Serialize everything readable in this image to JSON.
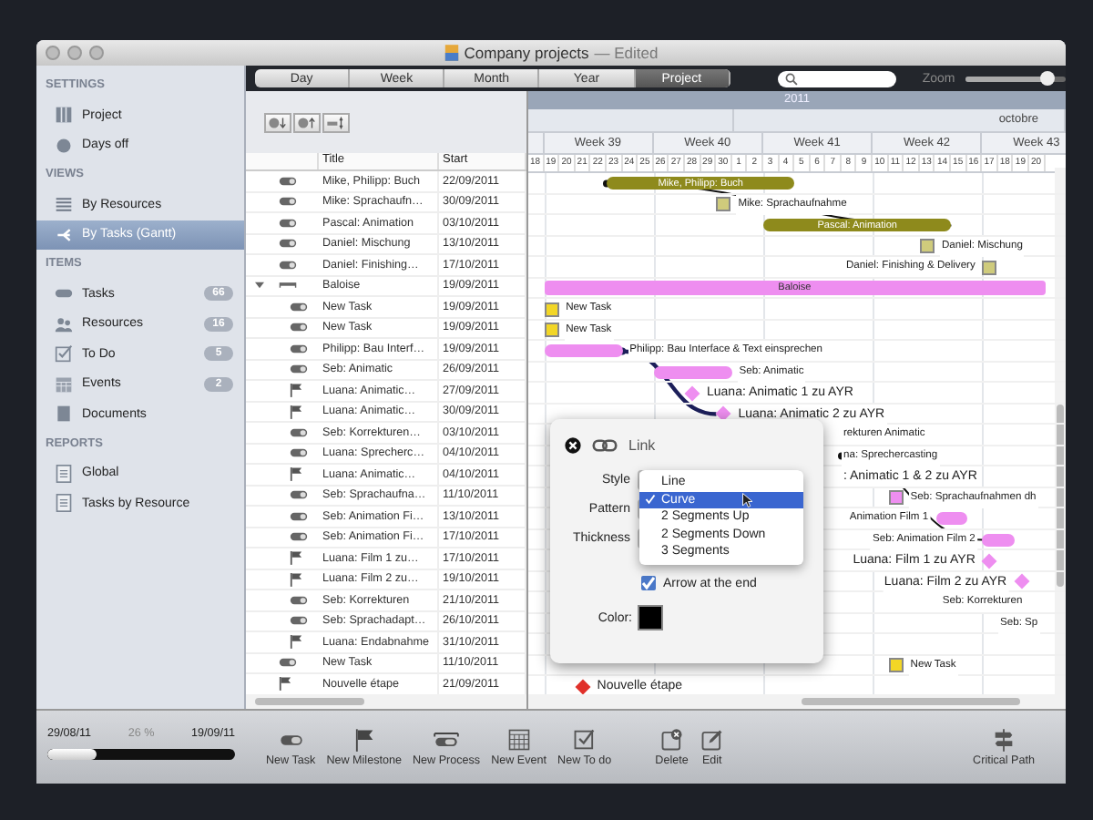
{
  "window": {
    "title": "Company projects",
    "status": "— Edited"
  },
  "sidebar": {
    "sections": [
      {
        "title": "SETTINGS",
        "items": [
          {
            "label": "Project",
            "selected": false
          },
          {
            "label": "Days off",
            "selected": false
          }
        ]
      },
      {
        "title": "VIEWS",
        "items": [
          {
            "label": "By Resources",
            "selected": false
          },
          {
            "label": "By Tasks (Gantt)",
            "selected": true
          }
        ]
      },
      {
        "title": "ITEMS",
        "items": [
          {
            "label": "Tasks",
            "count": "66",
            "selected": false
          },
          {
            "label": "Resources",
            "count": "16",
            "selected": false
          },
          {
            "label": "To Do",
            "count": "5",
            "selected": false
          },
          {
            "label": "Events",
            "count": "2",
            "selected": false
          },
          {
            "label": "Documents",
            "selected": false
          }
        ]
      },
      {
        "title": "REPORTS",
        "items": [
          {
            "label": "Global",
            "selected": false
          },
          {
            "label": "Tasks by Resource",
            "selected": false
          }
        ]
      }
    ],
    "progress": {
      "start": "29/08/11",
      "percent": "26 %",
      "end": "19/09/11",
      "level": 0.26
    }
  },
  "view_tabs": [
    {
      "label": "Day",
      "selected": false
    },
    {
      "label": "Week",
      "selected": false
    },
    {
      "label": "Month",
      "selected": false
    },
    {
      "label": "Year",
      "selected": false
    },
    {
      "label": "Project",
      "selected": true
    }
  ],
  "zoom": {
    "label": "Zoom",
    "level": 0.82
  },
  "table": {
    "columns": [
      "Title",
      "Start"
    ],
    "rows": [
      {
        "kind": "task",
        "title": "Mike, Philipp: Buch",
        "start": "22/09/2011",
        "bar": {
          "kind": "bar",
          "color": "#8e8a1c",
          "label": "Mike, Philipp: Buch"
        }
      },
      {
        "kind": "task",
        "title": "Mike: Sprachaufn…",
        "start": "30/09/2011",
        "bar": {
          "kind": "box",
          "color": "#cfcb7c",
          "label": "Mike: Sprachaufnahme"
        }
      },
      {
        "kind": "task",
        "title": "Pascal: Animation",
        "start": "03/10/2011",
        "bar": {
          "kind": "bar",
          "color": "#8e8a1c",
          "label": "Pascal: Animation"
        }
      },
      {
        "kind": "task",
        "title": "Daniel: Mischung",
        "start": "13/10/2011",
        "bar": {
          "kind": "box",
          "color": "#cfcb7c",
          "label": "Daniel: Mischung"
        }
      },
      {
        "kind": "task",
        "title": "Daniel: Finishing…",
        "start": "17/10/2011",
        "bar": {
          "kind": "box",
          "color": "#cfcb7c",
          "label": "Daniel: Finishing & Delivery"
        }
      },
      {
        "kind": "summary",
        "expanded": true,
        "title": "Baloise",
        "start": "19/09/2011",
        "bar": {
          "kind": "summary",
          "color": "#ee8ef0",
          "label": "Baloise"
        }
      },
      {
        "kind": "task",
        "title": "New Task",
        "start": "19/09/2011",
        "bar": {
          "kind": "box",
          "color": "#f2d626",
          "label": "New Task"
        }
      },
      {
        "kind": "task",
        "title": "New Task",
        "start": "19/09/2011",
        "bar": {
          "kind": "box",
          "color": "#f2d626",
          "label": "New Task"
        }
      },
      {
        "kind": "task",
        "title": "Philipp: Bau Interf…",
        "start": "19/09/2011",
        "bar": {
          "kind": "bar",
          "color": "#ee8ef0",
          "label": "Philipp: Bau Interface & Text einsprechen"
        }
      },
      {
        "kind": "task",
        "title": "Seb: Animatic",
        "start": "26/09/2011",
        "bar": {
          "kind": "bar",
          "color": "#ee8ef0",
          "label": "Seb: Animatic"
        }
      },
      {
        "kind": "milestone",
        "title": "Luana: Animatic…",
        "start": "27/09/2011",
        "bar": {
          "kind": "milestone",
          "color": "#ee8ef0",
          "label": "Luana: Animatic 1 zu AYR"
        }
      },
      {
        "kind": "milestone",
        "title": "Luana: Animatic…",
        "start": "30/09/2011",
        "bar": {
          "kind": "milestone",
          "color": "#ee8ef0",
          "label": "Luana: Animatic 2 zu AYR"
        }
      },
      {
        "kind": "task",
        "title": "Seb: Korrekturen…",
        "start": "03/10/2011",
        "bar": {
          "kind": "none",
          "label": "rekturen Animatic"
        }
      },
      {
        "kind": "task",
        "title": "Luana: Sprecherc…",
        "start": "04/10/2011",
        "bar": {
          "kind": "none",
          "label": "na: Sprechercasting"
        }
      },
      {
        "kind": "milestone",
        "title": "Luana: Animatic…",
        "start": "04/10/2011",
        "bar": {
          "kind": "none",
          "label": ": Animatic 1 & 2 zu AYR"
        }
      },
      {
        "kind": "task",
        "title": "Seb: Sprachaufna…",
        "start": "11/10/2011",
        "bar": {
          "kind": "box",
          "color": "#ee8ef0",
          "label": "Seb: Sprachaufnahmen dh"
        }
      },
      {
        "kind": "task",
        "title": "Seb: Animation Fi…",
        "start": "13/10/2011",
        "bar": {
          "kind": "bar",
          "color": "#ee8ef0",
          "label": "Animation Film 1"
        }
      },
      {
        "kind": "task",
        "title": "Seb: Animation Fi…",
        "start": "17/10/2011",
        "bar": {
          "kind": "bar",
          "color": "#ee8ef0",
          "label": "Seb: Animation Film 2"
        }
      },
      {
        "kind": "milestone",
        "title": "Luana: Film 1 zu…",
        "start": "17/10/2011",
        "bar": {
          "kind": "milestone",
          "color": "#ee8ef0",
          "label": "Luana: Film 1 zu AYR"
        }
      },
      {
        "kind": "milestone",
        "title": "Luana: Film 2 zu…",
        "start": "19/10/2011",
        "bar": {
          "kind": "milestone",
          "color": "#ee8ef0",
          "label": "Luana: Film 2 zu AYR"
        }
      },
      {
        "kind": "task",
        "title": "Seb: Korrekturen",
        "start": "21/10/2011",
        "bar": {
          "kind": "none",
          "label": "Seb: Korrekturen"
        }
      },
      {
        "kind": "task",
        "title": "Seb: Sprachadapt…",
        "start": "26/10/2011",
        "bar": {
          "kind": "none",
          "label": "Seb: Sp"
        }
      },
      {
        "kind": "milestone",
        "title": "Luana: Endabnahme",
        "start": "31/10/2011"
      },
      {
        "kind": "task",
        "title": "New Task",
        "start": "11/10/2011",
        "bar": {
          "kind": "box",
          "color": "#f2d626",
          "label": "New Task"
        }
      },
      {
        "kind": "milestone",
        "title": "Nouvelle étape",
        "start": "21/09/2011",
        "bar": {
          "kind": "milestone",
          "color": "#e0302a",
          "label": "Nouvelle étape"
        }
      }
    ]
  },
  "gantt": {
    "year": "2011",
    "month": "octobre",
    "weeks": [
      "Week 39",
      "Week 40",
      "Week 41",
      "Week 42",
      "Week 43"
    ],
    "days": [
      "18",
      "19",
      "20",
      "21",
      "22",
      "23",
      "24",
      "25",
      "26",
      "27",
      "28",
      "29",
      "30",
      "1",
      "2",
      "3",
      "4",
      "5",
      "6",
      "7",
      "8",
      "9",
      "10",
      "11",
      "12",
      "13",
      "14",
      "15",
      "16",
      "17",
      "18",
      "19",
      "20"
    ],
    "links": [
      {
        "selected": false
      },
      {
        "selected": true
      },
      {
        "selected": false
      }
    ]
  },
  "link_popover": {
    "title": "Link",
    "fields": [
      "Style",
      "Pattern",
      "Thickness"
    ],
    "style_options": [
      {
        "label": "Line",
        "selected": false
      },
      {
        "label": "Curve",
        "selected": true
      },
      {
        "label": "2 Segments Up",
        "selected": false
      },
      {
        "label": "2 Segments Down",
        "selected": false
      },
      {
        "label": "3 Segments",
        "selected": false
      }
    ],
    "arrow_at_end": {
      "label": "Arrow at the end",
      "checked": true
    },
    "color": {
      "label": "Color:",
      "color": "#000000"
    }
  },
  "toolbar": [
    "New Task",
    "New Milestone",
    "New Process",
    "New Event",
    "New To do",
    "Delete",
    "Edit",
    "Critical Path"
  ]
}
